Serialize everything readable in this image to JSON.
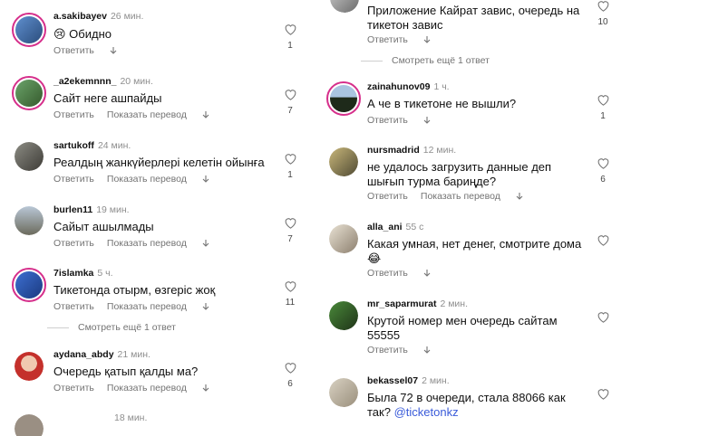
{
  "ui": {
    "reply": "Ответить",
    "translate": "Показать перевод",
    "view_more": "Смотреть ещё 1 ответ"
  },
  "left": [
    {
      "user": "a.sakibayev",
      "time": "26 мин.",
      "text": "😢 Обидно",
      "likes": "1",
      "translate": false
    },
    {
      "user": "_a2ekemnnn_",
      "time": "20 мин.",
      "text": "Сайт неге ашпайды",
      "likes": "7",
      "translate": true
    },
    {
      "user": "sartukoff",
      "time": "24 мин.",
      "text": "Реалдың жанкүйерлері келетін ойынға",
      "likes": "1",
      "translate": true
    },
    {
      "user": "burlen11",
      "time": "19 мин.",
      "text": "Сайыт ашылмады",
      "likes": "7",
      "translate": true
    },
    {
      "user": "7islamka",
      "time": "5 ч.",
      "text": "Тикетонда отырм, өзгеріс жоқ",
      "likes": "11",
      "translate": true
    },
    {
      "user": "aydana_abdy",
      "time": "21 мин.",
      "text": "Очередь қатып қалды ма?",
      "likes": "6",
      "translate": true
    }
  ],
  "right": [
    {
      "user": "",
      "time": "",
      "text": "Приложение Кайрат завис, очередь на тикетон завис",
      "likes": "10",
      "translate": false
    },
    {
      "user": "zainahunov09",
      "time": "1 ч.",
      "text": "А че в тикетоне не вышли?",
      "likes": "1",
      "translate": false
    },
    {
      "user": "nursmadrid",
      "time": "12 мин.",
      "text": "не удалось загрузить данные деп шығып турма бариңде?",
      "likes": "6",
      "translate": true
    },
    {
      "user": "alla_ani",
      "time": "55 с",
      "text": "Какая умная, нет денег, смотрите дома 😂",
      "likes": "",
      "translate": false
    },
    {
      "user": "mr_saparmurat",
      "time": "2 мин.",
      "text": "Крутой номер мен очередь сайтам 55555",
      "likes": "",
      "translate": false
    },
    {
      "user": "bekassel07",
      "time": "2 мин.",
      "text": "Была 72 в очереди, стала 88066 как так?",
      "mention": "@ticketonkz",
      "likes": "",
      "translate": false
    }
  ],
  "partial_bottom": {
    "user": "",
    "time": "18 мин."
  },
  "colors": {
    "ring": "#d62f8b",
    "mention": "#3a5bd9",
    "muted": "#737373"
  }
}
